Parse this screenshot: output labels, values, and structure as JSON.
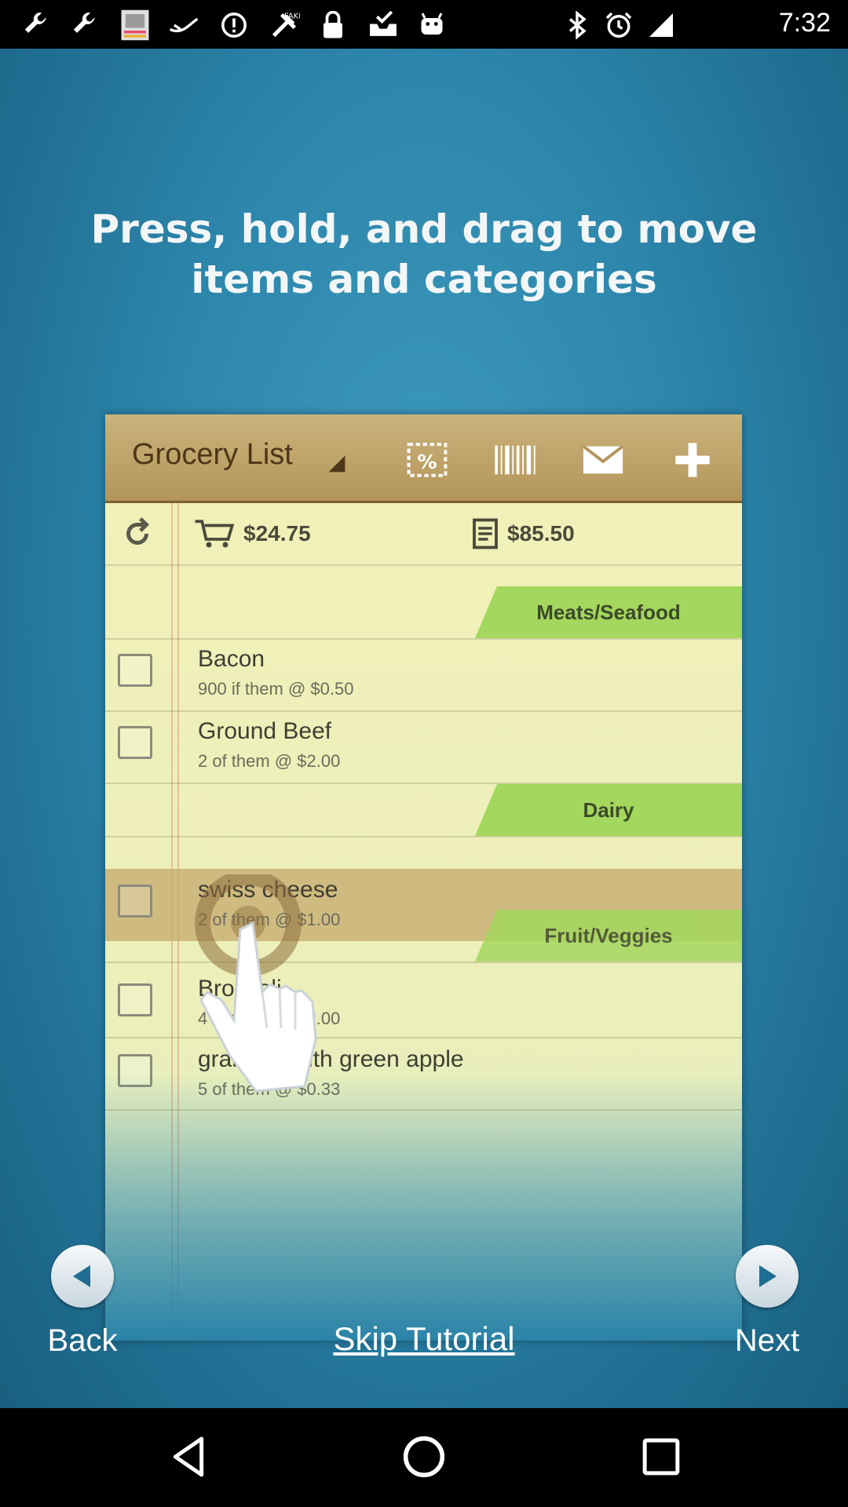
{
  "status_bar": {
    "time": "7:32",
    "left_icons": [
      "wrench-icon",
      "wrench-icon",
      "app-thumbnail-icon",
      "plane-icon",
      "alert-icon",
      "fake-gps-icon",
      "lock-icon",
      "checkbox-tray-icon",
      "android-icon"
    ],
    "right_icons": [
      "bluetooth-icon",
      "alarm-icon",
      "signal-icon"
    ]
  },
  "tutorial": {
    "instruction": "Press, hold, and drag to move\nitems and categories"
  },
  "app_preview": {
    "title": "Grocery List",
    "header_icons": [
      "dropdown-arrow-icon",
      "coupon-icon",
      "barcode-icon",
      "mail-icon",
      "plus-icon"
    ],
    "cart_total": "$24.75",
    "list_total": "$85.50",
    "categories": [
      {
        "name": "Meats/Seafood",
        "items": [
          {
            "name": "Bacon",
            "detail": "900 if them @ $0.50"
          },
          {
            "name": "Ground Beef",
            "detail": "2 of them @ $2.00"
          }
        ]
      },
      {
        "name": "Dairy",
        "items": [
          {
            "name": "swiss cheese",
            "detail": "2 of them @ $1.00"
          }
        ]
      },
      {
        "name": "Fruit/Veggies",
        "items": [
          {
            "name": "Broccoli",
            "detail": "4 of them @ $2.00"
          },
          {
            "name": "granny smith green apple",
            "detail": "5 of them @ $0.33"
          }
        ]
      }
    ]
  },
  "controls": {
    "back_label": "Back",
    "next_label": "Next",
    "skip_label": "Skip Tutorial"
  },
  "colors": {
    "background": "#2d86ab",
    "category_tab": "#a3d75d",
    "header": "#b3955a",
    "paper": "#f1f0b9"
  }
}
